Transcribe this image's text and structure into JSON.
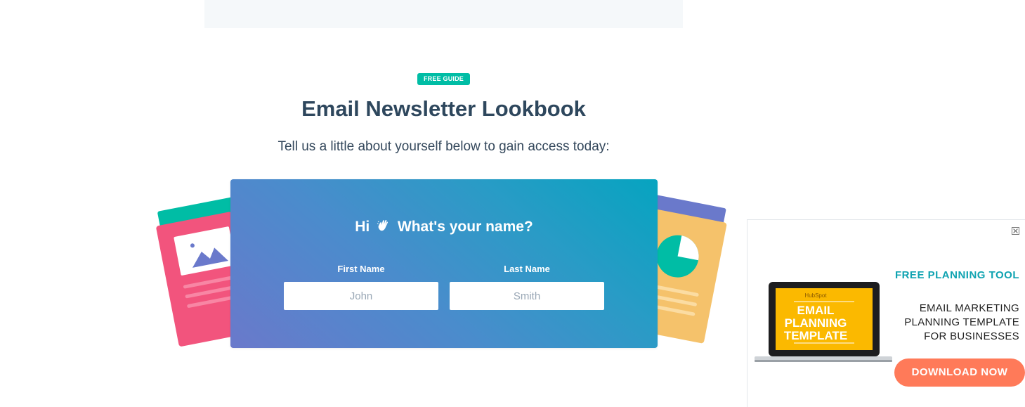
{
  "header_block": {},
  "badge": "FREE GUIDE",
  "title": "Email Newsletter Lookbook",
  "subtitle": "Tell us a little about yourself below to gain access today:",
  "form": {
    "greeting_hi": "Hi",
    "greeting_question": "What's your name?",
    "first_name_label": "First Name",
    "first_name_placeholder": "John",
    "last_name_label": "Last Name",
    "last_name_placeholder": "Smith"
  },
  "ad": {
    "tag": "FREE PLANNING TOOL",
    "lines": [
      "EMAIL MARKETING",
      "PLANNING TEMPLATE",
      "FOR BUSINESSES"
    ],
    "cta": "DOWNLOAD NOW",
    "laptop_brand": "HubSpot",
    "laptop_title": [
      "EMAIL",
      "PLANNING",
      "TEMPLATE"
    ]
  },
  "colors": {
    "accent_teal": "#00bda5",
    "form_gradient_start": "#6a79cb",
    "form_gradient_end": "#06a4c0",
    "cta_orange": "#ff7a59",
    "heading": "#2e475d"
  },
  "icons": {
    "wave": "waving-hand-icon",
    "close": "close-icon",
    "image": "image-icon",
    "pie": "pie-chart-icon"
  }
}
